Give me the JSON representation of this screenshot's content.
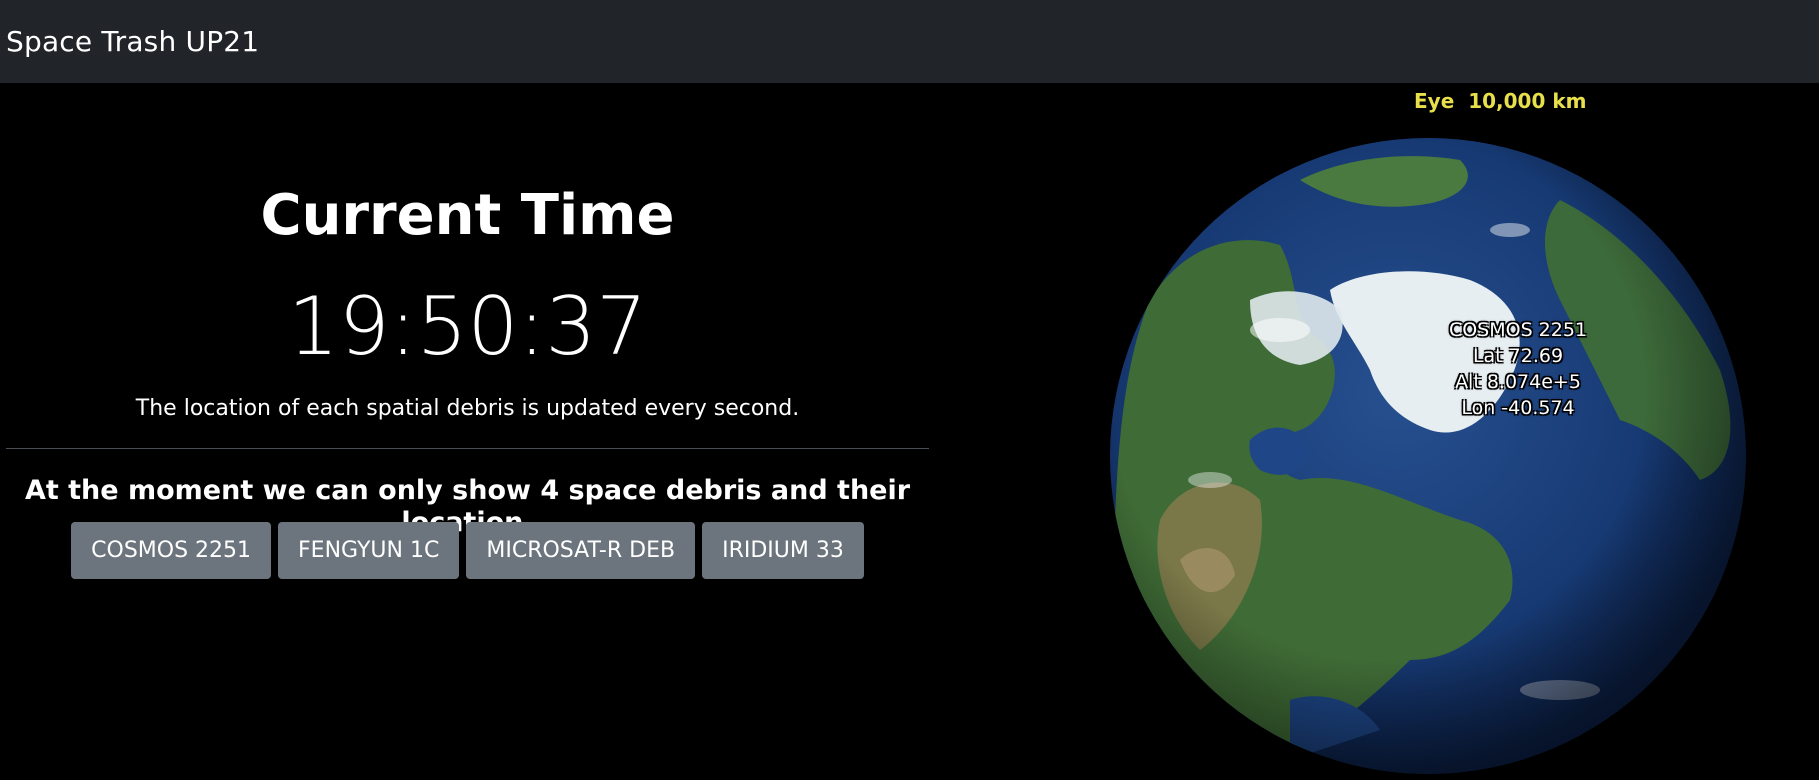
{
  "navbar": {
    "brand": "Space Trash UP21"
  },
  "main": {
    "heading": "Current Time",
    "clock": "19:50:37",
    "note": "The location of each spatial debris is updated every second.",
    "subheading": "At the moment we can only show 4 space debris and their location.",
    "debris_buttons": [
      "COSMOS 2251",
      "FENGYUN 1C",
      "MICROSAT-R DEB",
      "IRIDIUM 33"
    ]
  },
  "globe": {
    "eye_label": "Eye  10,000 km",
    "satellite": {
      "name": "COSMOS 2251",
      "lat": "Lat 72.69",
      "alt": "Alt 8.074e+5",
      "lon": "Lon -40.574"
    }
  },
  "colors": {
    "navbar_bg": "#212529",
    "button_bg": "#6c757d",
    "eye_label": "#e8e04a",
    "ocean": "#1a3a7a",
    "land": "#3f6b36",
    "ice": "#e6eef2"
  }
}
